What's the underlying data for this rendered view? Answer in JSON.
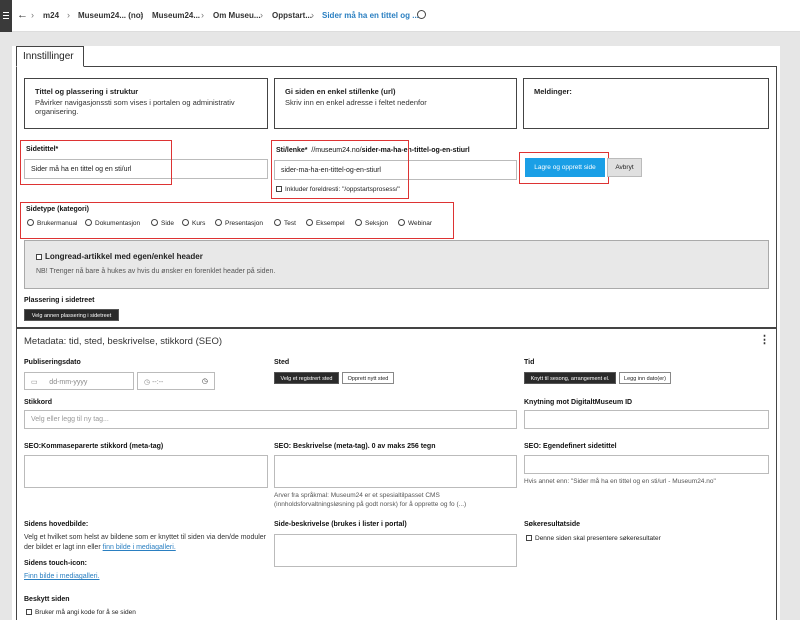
{
  "breadcrumb": {
    "items": [
      "m24",
      "Museum24... (no)",
      "Museum24...",
      "Om Museu...",
      "Oppstart...",
      "Sider må ha en tittel og ..."
    ]
  },
  "settings_tab": "Innstillinger",
  "cards": {
    "title_placement": {
      "heading": "Tittel og plassering i struktur",
      "text": "Påvirker navigasjonssti som vises i portalen og administrativ organisering."
    },
    "path": {
      "heading": "Gi siden en enkel sti/lenke (url)",
      "text": "Skriv inn en enkel adresse i feltet nedenfor"
    },
    "messages": {
      "heading": "Meldinger:"
    }
  },
  "page_title": {
    "label": "Sidetittel*",
    "value": "Sider må ha en tittel og en sti/url"
  },
  "path_field": {
    "label": "Sti/lenke*",
    "prefix": "//museum24.no/",
    "slug_bold": "sider-ma-ha-en-tittel-og-en-stiurl",
    "value": "sider-ma-ha-en-tittel-og-en-stiurl",
    "include_parent_label": "Inkluder foreldresti: \"/oppstartsprosess/\""
  },
  "buttons": {
    "save_create": "Lagre og opprett side",
    "cancel": "Avbryt",
    "choose_placement": "Velg annen plassering i sidetreet",
    "choose_registered_place": "Velg et registrert sted",
    "create_new_place": "Opprett nytt sted",
    "connect_season": "Knytt til sesong, arrangement el.",
    "add_dates": "Legg inn dato(er)"
  },
  "page_type": {
    "label": "Sidetype (kategori)",
    "options": [
      "Brukermanual",
      "Dokumentasjon",
      "Side",
      "Kurs",
      "Presentasjon",
      "Test",
      "Eksempel",
      "Seksjon",
      "Webinar"
    ]
  },
  "longread": {
    "label": "Longread-artikkel med egen/enkel header",
    "note": "NB! Trenger nå bare å hukes av hvis du ønsker en forenklet header på siden."
  },
  "placement_label": "Plassering i sidetreet",
  "metadata": {
    "heading": "Metadata: tid, sted, beskrivelse, stikkord (SEO)",
    "publish_date_label": "Publiseringsdato",
    "date_placeholder": "dd-mm-yyyy",
    "time_placeholder": "--:--",
    "place_label": "Sted",
    "time_label": "Tid",
    "keywords_label": "Stikkord",
    "keywords_placeholder": "Velg eller legg til ny tag...",
    "digitalt_label": "Knytning mot DigitaltMuseum ID",
    "seo_keywords_label": "SEO:Kommaseparerte stikkord (meta-tag)",
    "seo_desc_label": "SEO: Beskrivelse (meta-tag). 0 av maks 256 tegn",
    "seo_desc_help": "Arver fra språkmal: Museum24 er et spesialtilpasset CMS (innholdsforvaltningsløsning på godt norsk) for å opprette og fo (...)",
    "seo_title_label": "SEO: Egendefinert sidetittel",
    "seo_title_help": "Hvis annet enn: \"Sider må ha en tittel og en sti/url - Museum24.no\"",
    "main_image_label": "Sidens hovedbilde:",
    "main_image_text": "Velg et hvilket som helst av bildene som er knyttet til siden via den/de moduler der bildet er lagt inn eller",
    "main_image_link": "finn bilde i mediagalleri.",
    "touch_icon_label": "Sidens touch-icon:",
    "touch_icon_link": "Finn bilde i mediagalleri.",
    "side_desc_label": "Side-beskrivelse (brukes i lister i portal)",
    "search_label": "Søkeresultatside",
    "search_check": "Denne siden skal presentere søkeresultater",
    "protect_label": "Beskytt siden",
    "protect_check": "Bruker må angi kode for å se siden"
  },
  "colors": {
    "accent": "#1a9fe6",
    "highlight": "#dd3333",
    "link": "#2a7fc1"
  }
}
